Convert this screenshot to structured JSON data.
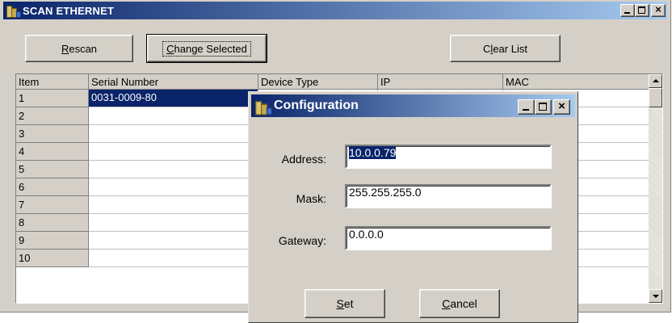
{
  "window": {
    "title": "SCAN ETHERNET"
  },
  "toolbar": {
    "rescan_label": "Rescan",
    "rescan_mnemonic": "R",
    "rescan_rest": "escan",
    "change_selected_label": "Change Selected",
    "change_mnemonic": "C",
    "change_rest": "hange Selected",
    "clear_list_label": "Clear List",
    "clear_pre": "C",
    "clear_mnemonic": "l",
    "clear_rest": "ear List"
  },
  "table": {
    "columns": [
      "Item",
      "Serial Number",
      "Device Type",
      "IP",
      "MAC"
    ],
    "rows": [
      {
        "item": "1",
        "serial": "0031-0009-80",
        "device_type": "",
        "ip": "",
        "mac": ""
      },
      {
        "item": "2",
        "serial": "",
        "device_type": "",
        "ip": "",
        "mac": ""
      },
      {
        "item": "3",
        "serial": "",
        "device_type": "",
        "ip": "",
        "mac": ""
      },
      {
        "item": "4",
        "serial": "",
        "device_type": "",
        "ip": "",
        "mac": ""
      },
      {
        "item": "5",
        "serial": "",
        "device_type": "",
        "ip": "",
        "mac": ""
      },
      {
        "item": "6",
        "serial": "",
        "device_type": "",
        "ip": "",
        "mac": ""
      },
      {
        "item": "7",
        "serial": "",
        "device_type": "",
        "ip": "",
        "mac": ""
      },
      {
        "item": "8",
        "serial": "",
        "device_type": "",
        "ip": "",
        "mac": ""
      },
      {
        "item": "9",
        "serial": "",
        "device_type": "",
        "ip": "",
        "mac": ""
      },
      {
        "item": "10",
        "serial": "",
        "device_type": "",
        "ip": "",
        "mac": ""
      }
    ],
    "selected_row": 0
  },
  "dialog": {
    "title": "Configuration",
    "address_label": "Address:",
    "address_value": "10.0.0.79",
    "mask_label": "Mask:",
    "mask_value": "255.255.255.0",
    "gateway_label": "Gateway:",
    "gateway_value": "0.0.0.0",
    "set_label": "Set",
    "set_mnemonic": "S",
    "set_rest": "et",
    "cancel_label": "Cancel",
    "cancel_mnemonic": "C",
    "cancel_rest": "ancel"
  },
  "colors": {
    "titlebar_start": "#0a246a",
    "titlebar_end": "#a6caf0",
    "face": "#d4d0c8",
    "selection": "#0a246a"
  },
  "icons": [
    "app-icon",
    "minimize-icon",
    "maximize-icon",
    "close-icon",
    "scroll-up-icon",
    "scroll-down-icon"
  ]
}
